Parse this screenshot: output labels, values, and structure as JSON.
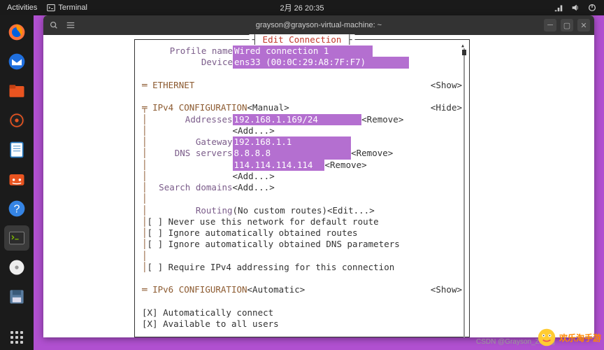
{
  "topbar": {
    "activities": "Activities",
    "app": "Terminal",
    "clock": "2月 26 20:35"
  },
  "window": {
    "title": "grayson@grayson-virtual-machine: ~"
  },
  "nmtui": {
    "title_prefix": "┤ ",
    "title": "Edit Connection",
    "title_suffix": " ├",
    "profile_name_label": "Profile name",
    "profile_name": "Wired connection 1        ",
    "device_label": "Device",
    "device": "ens33 (00:0C:29:A8:7F:F7)        ",
    "ethernet_label": "ETHERNET",
    "show": "<Show>",
    "hide": "<Hide>",
    "ipv4_label": "IPv4 CONFIGURATION",
    "ipv4_mode": "<Manual>",
    "addresses_label": "Addresses",
    "address1": "192.168.1.169/24        ",
    "add": "<Add...>",
    "remove": "<Remove>",
    "gateway_label": "Gateway",
    "gateway": "192.168.1.1           ",
    "dns_label": "DNS servers",
    "dns1": "8.8.8.8               ",
    "dns2": "114.114.114.114  ",
    "search_label": "Search domains",
    "routing_label": "Routing",
    "routing_value": "(No custom routes)",
    "edit": "<Edit...>",
    "opt1": "Never use this network for default route",
    "opt2": "Ignore automatically obtained routes",
    "opt3": "Ignore automatically obtained DNS parameters",
    "opt4": "Require IPv4 addressing for this connection",
    "ipv6_label": "IPv6 CONFIGURATION",
    "ipv6_mode": "<Automatic>",
    "auto_connect": "Automatically connect",
    "avail_all": "Available to all users",
    "cb_unchecked": "[ ]",
    "cb_checked": "[X]",
    "marker": "═",
    "bar": "│"
  },
  "watermark": {
    "csdn": "CSDN @Grayson_Zheng",
    "brand": "欢乐淘手游"
  }
}
